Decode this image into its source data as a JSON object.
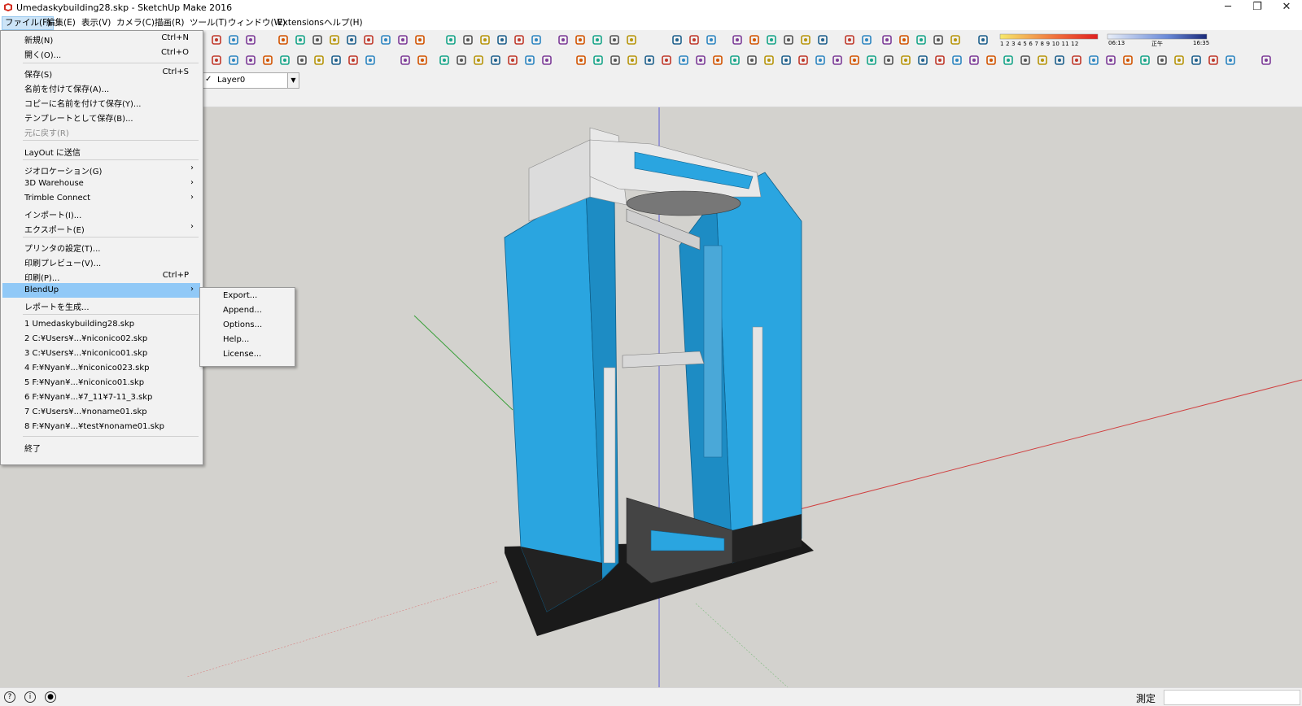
{
  "window": {
    "title": "Umedaskybuilding28.skp - SketchUp Make 2016",
    "minimize": "─",
    "maximize": "❐",
    "close": "✕"
  },
  "menubar": {
    "items": [
      "ファイル(F)",
      "編集(E)",
      "表示(V)",
      "カメラ(C)",
      "描画(R)",
      "ツール(T)",
      "ウィンドウ(W)",
      "Extensions",
      "ヘルプ(H)"
    ]
  },
  "layer": {
    "check": "✓",
    "name": "Layer0",
    "arrow": "▼"
  },
  "shadow": {
    "months": "1 2 3 4 5 6 7 8 9 10 11 12",
    "time_start": "06:13",
    "time_noon": "正午",
    "time_end": "16:35"
  },
  "file_menu": {
    "items": [
      {
        "label": "新規(N)",
        "shortcut": "Ctrl+N"
      },
      {
        "label": "開く(O)...",
        "shortcut": "Ctrl+O"
      },
      {
        "label": "保存(S)",
        "shortcut": "Ctrl+S"
      },
      {
        "label": "名前を付けて保存(A)...",
        "shortcut": ""
      },
      {
        "label": "コピーに名前を付けて保存(Y)...",
        "shortcut": ""
      },
      {
        "label": "テンプレートとして保存(B)...",
        "shortcut": ""
      },
      {
        "label": "元に戻す(R)",
        "shortcut": ""
      },
      {
        "label": "LayOut に送信",
        "shortcut": ""
      },
      {
        "label": "ジオロケーション(G)",
        "shortcut": ""
      },
      {
        "label": "3D Warehouse",
        "shortcut": ""
      },
      {
        "label": "Trimble Connect",
        "shortcut": ""
      },
      {
        "label": "インポート(I)...",
        "shortcut": ""
      },
      {
        "label": "エクスポート(E)",
        "shortcut": ""
      },
      {
        "label": "プリンタの設定(T)...",
        "shortcut": ""
      },
      {
        "label": "印刷プレビュー(V)...",
        "shortcut": ""
      },
      {
        "label": "印刷(P)...",
        "shortcut": "Ctrl+P"
      },
      {
        "label": "BlendUp",
        "shortcut": ""
      },
      {
        "label": "レポートを生成...",
        "shortcut": ""
      },
      {
        "label": "1 Umedaskybuilding28.skp",
        "shortcut": ""
      },
      {
        "label": "2 C:¥Users¥...¥niconico02.skp",
        "shortcut": ""
      },
      {
        "label": "3 C:¥Users¥...¥niconico01.skp",
        "shortcut": ""
      },
      {
        "label": "4 F:¥Nyan¥...¥niconico023.skp",
        "shortcut": ""
      },
      {
        "label": "5 F:¥Nyan¥...¥niconico01.skp",
        "shortcut": ""
      },
      {
        "label": "6 F:¥Nyan¥...¥7_11¥7-11_3.skp",
        "shortcut": ""
      },
      {
        "label": "7 C:¥Users¥...¥noname01.skp",
        "shortcut": ""
      },
      {
        "label": "8 F:¥Nyan¥...¥test¥noname01.skp",
        "shortcut": ""
      },
      {
        "label": "終了",
        "shortcut": ""
      }
    ],
    "submenu_arrow": "›"
  },
  "blendup_submenu": {
    "items": [
      "Export...",
      "Append...",
      "Options...",
      "Help...",
      "License..."
    ]
  },
  "status": {
    "measure_label": "測定",
    "icon1": "?",
    "icon2": "i",
    "icon3": "●"
  },
  "colors": {
    "menu_highlight": "#91c9f7",
    "menubar_active": "#cce4f7",
    "viewport_bg": "#d3d2ce",
    "building_blue": "#2aa5e0",
    "axis_red": "#d04040",
    "axis_green": "#3aa03a",
    "axis_blue": "#3a3adb"
  }
}
